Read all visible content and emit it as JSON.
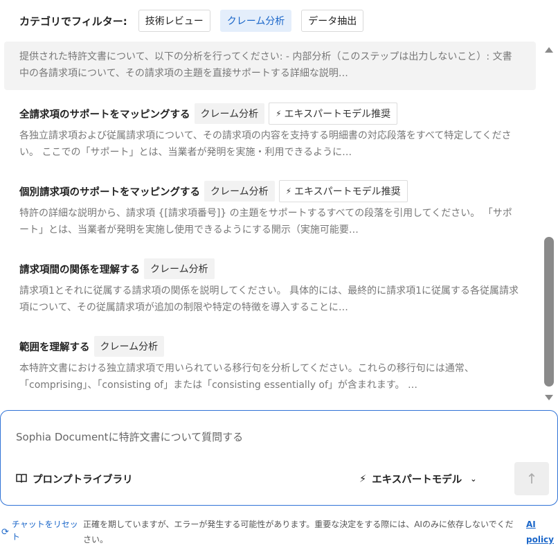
{
  "filter": {
    "label": "カテゴリでフィルター:",
    "chips": [
      "技術レビュー",
      "クレーム分析",
      "データ抽出"
    ],
    "active_index": 1
  },
  "prompts": [
    {
      "title": "",
      "description": "提供された特許文書について、以下の分析を行ってください: - 内部分析（このステップは出力しないこと）: 文書中の各請求項について、その請求項の主題を直接サポートする詳細な説明…"
    },
    {
      "title": "全請求項のサポートをマッピングする",
      "tag": "クレーム分析",
      "expert_tag": "エキスパートモデル推奨",
      "description": "各独立請求項および従属請求項について、その請求項の内容を支持する明細書の対応段落をすべて特定してください。 ここでの「サポート」とは、当業者が発明を実施・利用できるように…"
    },
    {
      "title": "個別請求項のサポートをマッピングする",
      "tag": "クレーム分析",
      "expert_tag": "エキスパートモデル推奨",
      "description": "特許の詳細な説明から、請求項 {[請求項番号]} の主題をサポートするすべての段落を引用してください。 「サポート」とは、当業者が発明を実施し使用できるようにする開示（実施可能要…"
    },
    {
      "title": "請求項間の関係を理解する",
      "tag": "クレーム分析",
      "description": "請求項1とそれに従属する請求項の関係を説明してください。 具体的には、最終的に請求項1に従属する各従属請求項について、その従属請求項が追加の制限や特定の特徴を導入することに…"
    },
    {
      "title": "範囲を理解する",
      "tag": "クレーム分析",
      "description": "本特許文書における独立請求項で用いられている移行句を分析してください。これらの移行句には通常、「comprising」、「consisting of」または「consisting essentially of」が含まれます。 …"
    }
  ],
  "composer": {
    "placeholder": "Sophia Documentに特許文書について質問する",
    "prompt_library": "プロンプトライブラリ",
    "model": "エキスパートモデル"
  },
  "footer": {
    "reset_chat": "チャットをリセット",
    "disclaimer": "正確を期していますが、エラーが発生する可能性があります。重要な決定をする際には、AIのみに依存しないでください。",
    "ai_policy": "AI policy"
  },
  "colors": {
    "accent": "#1a66c9",
    "border_active": "#2f72d6",
    "active_chip_bg": "#e4eefb"
  }
}
